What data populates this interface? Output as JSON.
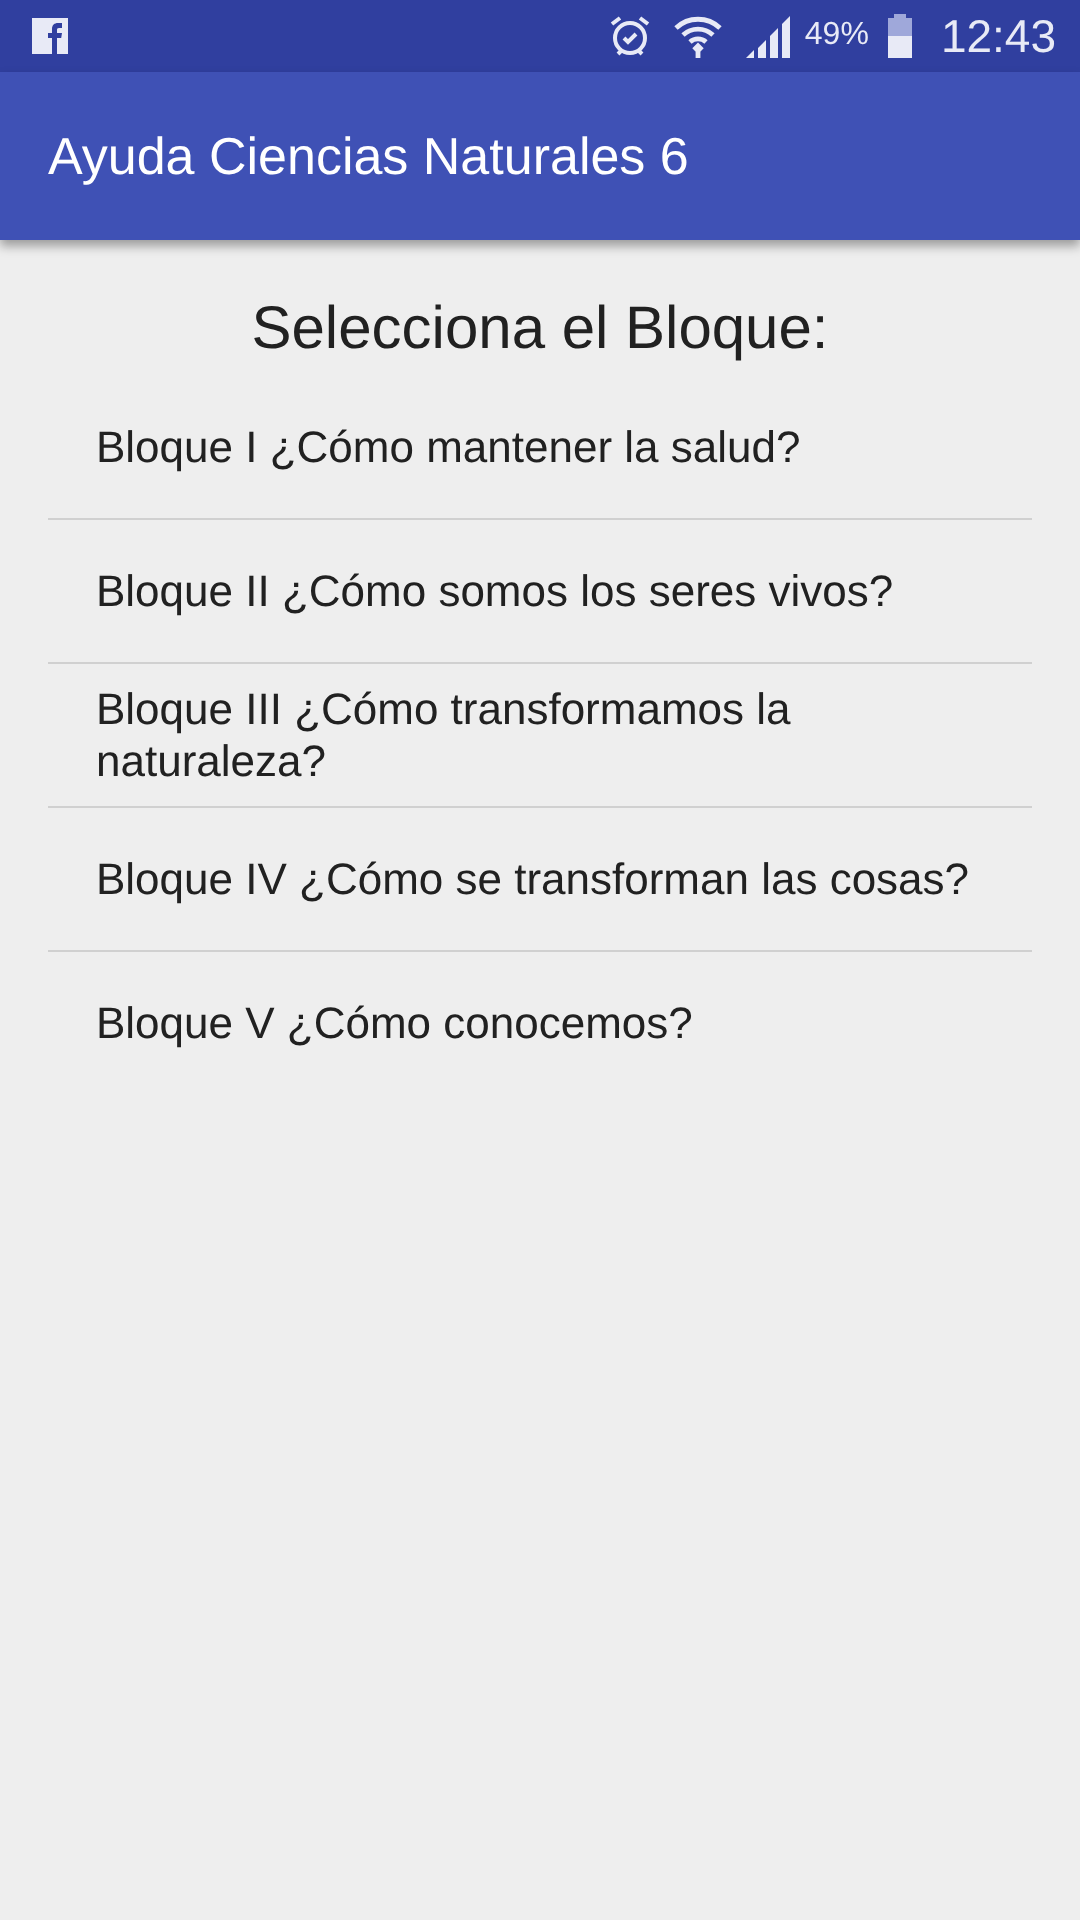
{
  "status_bar": {
    "battery": "49%",
    "time": "12:43"
  },
  "app_bar": {
    "title": "Ayuda Ciencias Naturales 6"
  },
  "heading": "Selecciona el Bloque:",
  "items": [
    {
      "label": "Bloque I ¿Cómo mantener la salud?"
    },
    {
      "label": "Bloque II ¿Cómo somos los seres vivos?"
    },
    {
      "label": "Bloque III ¿Cómo transformamos la naturaleza?"
    },
    {
      "label": "Bloque IV ¿Cómo se transforman las cosas?"
    },
    {
      "label": "Bloque V ¿Cómo conocemos?"
    }
  ]
}
